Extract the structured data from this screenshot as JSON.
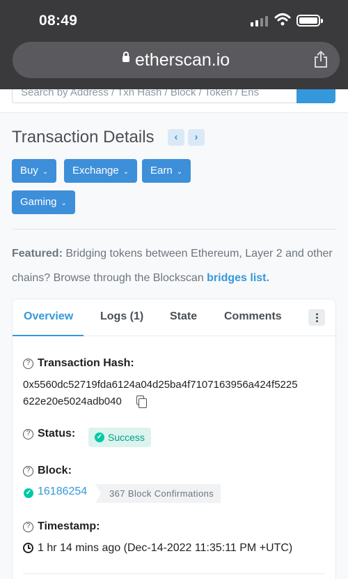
{
  "status_bar": {
    "time": "08:49"
  },
  "browser": {
    "url": "etherscan.io"
  },
  "search": {
    "placeholder": "Search by Address / Txn Hash / Block / Token / Ens"
  },
  "page": {
    "title": "Transaction Details"
  },
  "menu_buttons": [
    "Buy",
    "Exchange",
    "Earn",
    "Gaming"
  ],
  "featured": {
    "label": "Featured:",
    "text": " Bridging tokens between Ethereum, Layer 2 and other chains? Browse through the Blockscan ",
    "link": "bridges list."
  },
  "tabs": [
    "Overview",
    "Logs (1)",
    "State",
    "Comments"
  ],
  "details": {
    "hash_label": "Transaction Hash:",
    "hash_line1": "0x5560dc52719fda6124a04d25ba4f7107163956a424f5225",
    "hash_line2": "622e20e5024adb040",
    "status_label": "Status:",
    "status_value": "Success",
    "block_label": "Block:",
    "block_number": "16186254",
    "block_confirmations": "367 Block Confirmations",
    "timestamp_label": "Timestamp:",
    "timestamp_value": "1 hr 14 mins ago (Dec-14-2022 11:35:11 PM +UTC)"
  },
  "colors": {
    "accent": "#3498db",
    "button": "#3d8fd9",
    "success": "#00c9a7",
    "topbar": "#3a3a3c"
  }
}
